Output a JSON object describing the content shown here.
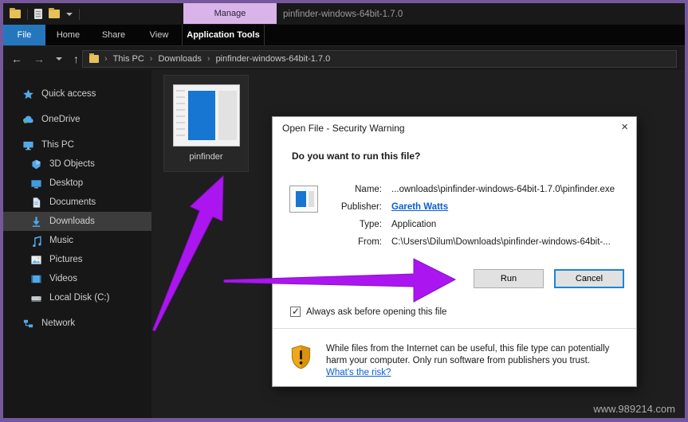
{
  "window": {
    "title": "pinfinder-windows-64bit-1.7.0",
    "manage_tab": "Manage"
  },
  "ribbon": {
    "tabs": [
      "File",
      "Home",
      "Share",
      "View",
      "Application Tools"
    ]
  },
  "addressbar": {
    "separator": "›",
    "crumbs": [
      "This PC",
      "Downloads",
      "pinfinder-windows-64bit-1.7.0"
    ]
  },
  "sidebar": {
    "items": [
      {
        "label": "Quick access"
      },
      {
        "label": "OneDrive"
      },
      {
        "label": "This PC"
      },
      {
        "label": "3D Objects"
      },
      {
        "label": "Desktop"
      },
      {
        "label": "Documents"
      },
      {
        "label": "Downloads"
      },
      {
        "label": "Music"
      },
      {
        "label": "Pictures"
      },
      {
        "label": "Videos"
      },
      {
        "label": "Local Disk (C:)"
      },
      {
        "label": "Network"
      }
    ]
  },
  "files": {
    "selected_file": "pinfinder"
  },
  "dialog": {
    "title": "Open File - Security Warning",
    "question": "Do you want to run this file?",
    "name_label": "Name:",
    "name_value": "...ownloads\\pinfinder-windows-64bit-1.7.0\\pinfinder.exe",
    "publisher_label": "Publisher:",
    "publisher_value": "Gareth Watts",
    "type_label": "Type:",
    "type_value": "Application",
    "from_label": "From:",
    "from_value": "C:\\Users\\Dilum\\Downloads\\pinfinder-windows-64bit-...",
    "run_button": "Run",
    "cancel_button": "Cancel",
    "checkbox_label": "Always ask before opening this file",
    "warning_text": "While files from the Internet can be useful, this file type can potentially harm your computer. Only run software from publishers you trust.",
    "risk_link": "What's the risk?"
  },
  "watermark": "www.989214.com",
  "colors": {
    "annotation_arrow": "#ab16f0",
    "frame_purple": "#75589c",
    "file_tab_blue": "#2577bd",
    "manage_tab_purple": "#d9b4e9",
    "link_blue": "#0b5fd0"
  }
}
